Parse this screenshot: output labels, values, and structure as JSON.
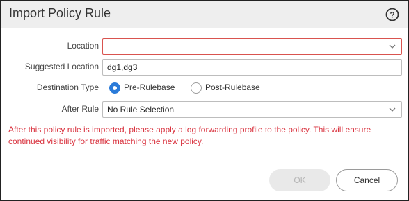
{
  "dialog": {
    "title": "Import Policy Rule",
    "help_icon": "help-circle-icon"
  },
  "form": {
    "location": {
      "label": "Location",
      "value": "",
      "state": "invalid",
      "icon": "chevron-down-icon"
    },
    "suggested_location": {
      "label": "Suggested Location",
      "value": "dg1,dg3"
    },
    "destination_type": {
      "label": "Destination Type",
      "options": [
        {
          "label": "Pre-Rulebase",
          "selected": true
        },
        {
          "label": "Post-Rulebase",
          "selected": false
        }
      ]
    },
    "after_rule": {
      "label": "After Rule",
      "value": "No Rule Selection",
      "icon": "chevron-down-icon"
    }
  },
  "warning": {
    "text": "After this policy rule is imported, please apply a log forwarding profile to the policy. This will ensure continued visibility for traffic matching the new policy."
  },
  "buttons": {
    "ok": {
      "label": "OK",
      "enabled": false
    },
    "cancel": {
      "label": "Cancel",
      "enabled": true
    }
  },
  "colors": {
    "accent": "#2b7bd9",
    "error": "#d9333f",
    "titlebar": "#eeeeee"
  }
}
